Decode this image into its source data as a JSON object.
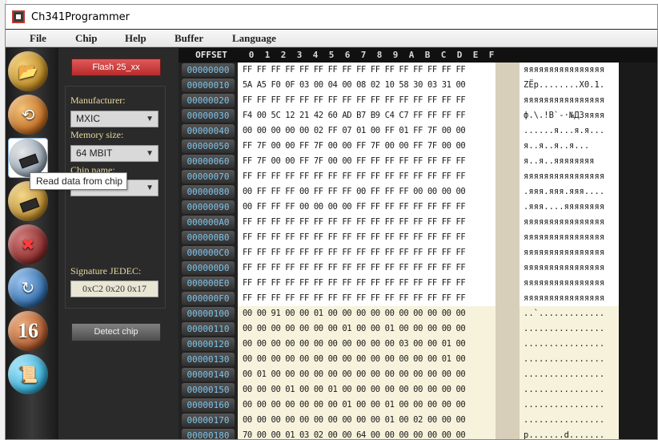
{
  "window": {
    "title": "Ch341Programmer",
    "app_icon": "chip-app-icon"
  },
  "menu": [
    "File",
    "Chip",
    "Help",
    "Buffer",
    "Language"
  ],
  "toolbar": {
    "tools": [
      {
        "icon": "open-file-icon",
        "color": "#c99a3a"
      },
      {
        "icon": "save-file-icon",
        "color": "#c9772a"
      },
      {
        "icon": "read-chip-icon",
        "color": "#6a8fb0"
      },
      {
        "icon": "write-chip-icon",
        "color": "#b8872a"
      },
      {
        "icon": "erase-chip-icon",
        "color": "#a33a3a"
      },
      {
        "icon": "verify-chip-icon",
        "color": "#3a6fb0"
      },
      {
        "icon": "hex-16-icon",
        "label": "16",
        "color": "#a8552a"
      },
      {
        "icon": "scroll-icon",
        "color": "#3aaad0"
      }
    ],
    "tooltip": "Read data from chip"
  },
  "panel": {
    "flash_button": "Flash 25_xx",
    "manufacturer_label": "Manufacturer:",
    "manufacturer_value": "MXIC",
    "memory_label": "Memory size:",
    "memory_value": "64 MBIT",
    "chipname_label": "Chip name:",
    "chipname_value": "",
    "jedec_label": "Signature JEDEC:",
    "jedec_value": "0xC2  0x20  0x17",
    "detect_button": "Detect chip"
  },
  "hex": {
    "offset_header": "OFFSET",
    "columns": [
      "0",
      "1",
      "2",
      "3",
      "4",
      "5",
      "6",
      "7",
      "8",
      "9",
      "A",
      "B",
      "C",
      "D",
      "E",
      "F"
    ],
    "rows": [
      {
        "addr": "00000000",
        "bytes": "FF FF FF FF FF FF FF FF FF FF FF FF FF FF FF FF",
        "ascii": "яяяяяяяяяяяяяяяя"
      },
      {
        "addr": "00000010",
        "bytes": "5A A5 F0 0F 03 00 04 00 08 02 10 58 30 03 31 00",
        "ascii": "ZЁр........X0.1."
      },
      {
        "addr": "00000020",
        "bytes": "FF FF FF FF FF FF FF FF FF FF FF FF FF FF FF FF",
        "ascii": "яяяяяяяяяяяяяяяя"
      },
      {
        "addr": "00000030",
        "bytes": "F4 00 5C 12 21 42 60 AD B7 B9 C4 C7 FF FF FF FF",
        "ascii": "ф.\\.!B`-·№ДЗяяяя"
      },
      {
        "addr": "00000040",
        "bytes": "00 00 00 00 00 02 FF 07 01 00 FF 01 FF 7F 00 00",
        "ascii": "......я...я.я..."
      },
      {
        "addr": "00000050",
        "bytes": "FF 7F 00 00 FF 7F 00 00 FF 7F 00 00 FF 7F 00 00",
        "ascii": "я..я..я..я..."
      },
      {
        "addr": "00000060",
        "bytes": "FF 7F 00 00 FF 7F 00 00 FF FF FF FF FF FF FF FF",
        "ascii": "я..я..яяяяяяяя"
      },
      {
        "addr": "00000070",
        "bytes": "FF FF FF FF FF FF FF FF FF FF FF FF FF FF FF FF",
        "ascii": "яяяяяяяяяяяяяяяя"
      },
      {
        "addr": "00000080",
        "bytes": "00 FF FF FF 00 FF FF FF 00 FF FF FF 00 00 00 00",
        "ascii": ".яяя.яяя.яяя...."
      },
      {
        "addr": "00000090",
        "bytes": "00 FF FF FF 00 00 00 00 FF FF FF FF FF FF FF FF",
        "ascii": ".яяя....яяяяяяяя"
      },
      {
        "addr": "000000A0",
        "bytes": "FF FF FF FF FF FF FF FF FF FF FF FF FF FF FF FF",
        "ascii": "яяяяяяяяяяяяяяяя"
      },
      {
        "addr": "000000B0",
        "bytes": "FF FF FF FF FF FF FF FF FF FF FF FF FF FF FF FF",
        "ascii": "яяяяяяяяяяяяяяяя"
      },
      {
        "addr": "000000C0",
        "bytes": "FF FF FF FF FF FF FF FF FF FF FF FF FF FF FF FF",
        "ascii": "яяяяяяяяяяяяяяяя"
      },
      {
        "addr": "000000D0",
        "bytes": "FF FF FF FF FF FF FF FF FF FF FF FF FF FF FF FF",
        "ascii": "яяяяяяяяяяяяяяяя"
      },
      {
        "addr": "000000E0",
        "bytes": "FF FF FF FF FF FF FF FF FF FF FF FF FF FF FF FF",
        "ascii": "яяяяяяяяяяяяяяяя"
      },
      {
        "addr": "000000F0",
        "bytes": "FF FF FF FF FF FF FF FF FF FF FF FF FF FF FF FF",
        "ascii": "яяяяяяяяяяяяяяяя"
      },
      {
        "addr": "00000100",
        "bytes": "00 00 91 00 00 01 00 00 00 00 00 00 00 00 00 00",
        "ascii": "..`............."
      },
      {
        "addr": "00000110",
        "bytes": "00 00 00 00 00 00 00 01 00 00 01 00 00 00 00 00",
        "ascii": "................"
      },
      {
        "addr": "00000120",
        "bytes": "00 00 00 00 00 00 00 00 00 00 00 03 00 00 01 00",
        "ascii": "................"
      },
      {
        "addr": "00000130",
        "bytes": "00 00 00 00 00 00 00 00 00 00 00 00 00 00 01 00",
        "ascii": "................"
      },
      {
        "addr": "00000140",
        "bytes": "00 01 00 00 00 00 00 00 00 00 00 00 00 00 00 00",
        "ascii": "................"
      },
      {
        "addr": "00000150",
        "bytes": "00 00 00 01 00 00 01 00 00 00 00 00 00 00 00 00",
        "ascii": "................"
      },
      {
        "addr": "00000160",
        "bytes": "00 00 00 00 00 00 00 01 00 00 01 00 00 00 00 00",
        "ascii": "................"
      },
      {
        "addr": "00000170",
        "bytes": "00 00 00 00 00 00 00 00 00 00 01 00 02 00 00 00",
        "ascii": "................"
      },
      {
        "addr": "00000180",
        "bytes": "70 00 00 01 03 02 00 00 64 00 00 00 00 00 00 00",
        "ascii": "p.......d......."
      }
    ]
  }
}
